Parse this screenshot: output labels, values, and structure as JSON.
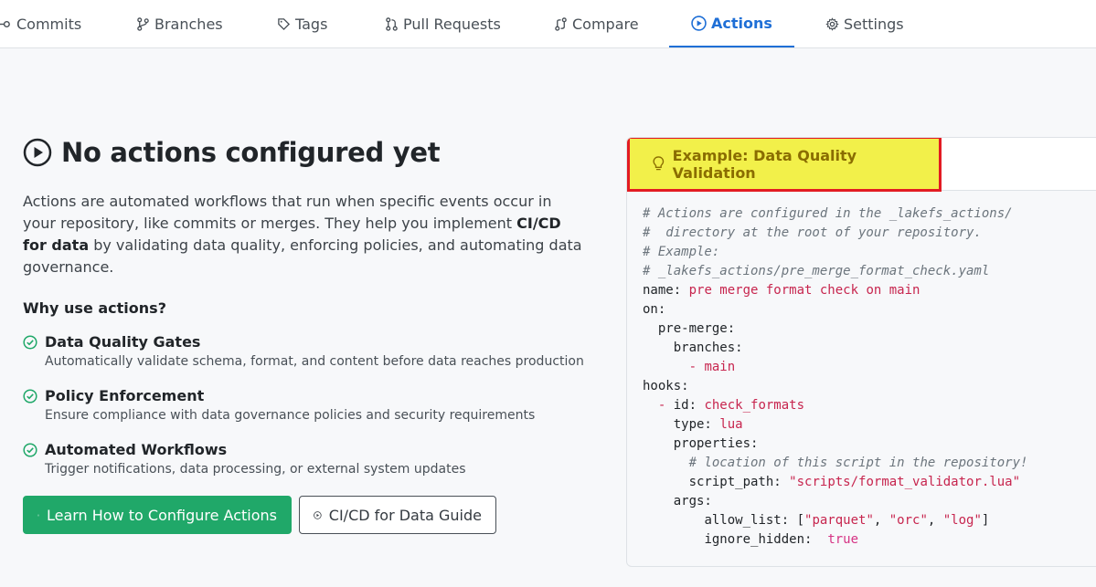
{
  "tabs": [
    {
      "label": "Commits",
      "icon": "commit-icon"
    },
    {
      "label": "Branches",
      "icon": "branch-icon"
    },
    {
      "label": "Tags",
      "icon": "tag-icon"
    },
    {
      "label": "Pull Requests",
      "icon": "pull-request-icon"
    },
    {
      "label": "Compare",
      "icon": "compare-icon"
    },
    {
      "label": "Actions",
      "icon": "play-icon",
      "active": true
    },
    {
      "label": "Settings",
      "icon": "gear-icon"
    }
  ],
  "main": {
    "title": "No actions configured yet",
    "description_part1": "Actions are automated workflows that run when specific events occur in your repository, like commits or merges. They help you implement ",
    "description_bold": "CI/CD for data",
    "description_part2": " by validating data quality, enforcing policies, and automating data governance.",
    "why_heading": "Why use actions?",
    "features": [
      {
        "title": "Data Quality Gates",
        "desc": "Automatically validate schema, format, and content before data reaches production"
      },
      {
        "title": "Policy Enforcement",
        "desc": "Ensure compliance with data governance policies and security requirements"
      },
      {
        "title": "Automated Workflows",
        "desc": "Trigger notifications, data processing, or external system updates"
      }
    ],
    "primary_button": "Learn How to Configure Actions",
    "secondary_button": "CI/CD for Data Guide"
  },
  "example": {
    "header": "Example: Data Quality Validation",
    "code_lines": [
      {
        "t": "comment",
        "text": "# Actions are configured in the _lakefs_actions/"
      },
      {
        "t": "comment",
        "text": "#  directory at the root of your repository."
      },
      {
        "t": "comment",
        "text": "# Example:"
      },
      {
        "t": "comment",
        "text": "# _lakefs_actions/pre_merge_format_check.yaml"
      },
      {
        "t": "kv",
        "indent": "",
        "key": "name:",
        "val": "pre merge format check on main"
      },
      {
        "t": "kv",
        "indent": "",
        "key": "on:",
        "val": ""
      },
      {
        "t": "kv",
        "indent": "  ",
        "key": "pre-merge:",
        "val": ""
      },
      {
        "t": "kv",
        "indent": "    ",
        "key": "branches:",
        "val": ""
      },
      {
        "t": "list",
        "indent": "      ",
        "key": "- ",
        "val": "main"
      },
      {
        "t": "kv",
        "indent": "",
        "key": "hooks:",
        "val": ""
      },
      {
        "t": "list",
        "indent": "  ",
        "key": "- ",
        "val2key": "id:",
        "val": "check_formats"
      },
      {
        "t": "kv",
        "indent": "    ",
        "key": "type:",
        "val": "lua"
      },
      {
        "t": "kv",
        "indent": "    ",
        "key": "properties:",
        "val": ""
      },
      {
        "t": "comment",
        "indent": "      ",
        "text": "# location of this script in the repository!"
      },
      {
        "t": "kv",
        "indent": "      ",
        "key": "script_path:",
        "val": "\"scripts/format_validator.lua\""
      },
      {
        "t": "kv",
        "indent": "    ",
        "key": "args:",
        "val": ""
      },
      {
        "t": "arr",
        "indent": "        ",
        "key": "allow_list:",
        "items": [
          "\"parquet\"",
          "\"orc\"",
          "\"log\""
        ]
      },
      {
        "t": "kv",
        "indent": "        ",
        "key": "ignore_hidden:",
        "val": " true"
      }
    ]
  }
}
